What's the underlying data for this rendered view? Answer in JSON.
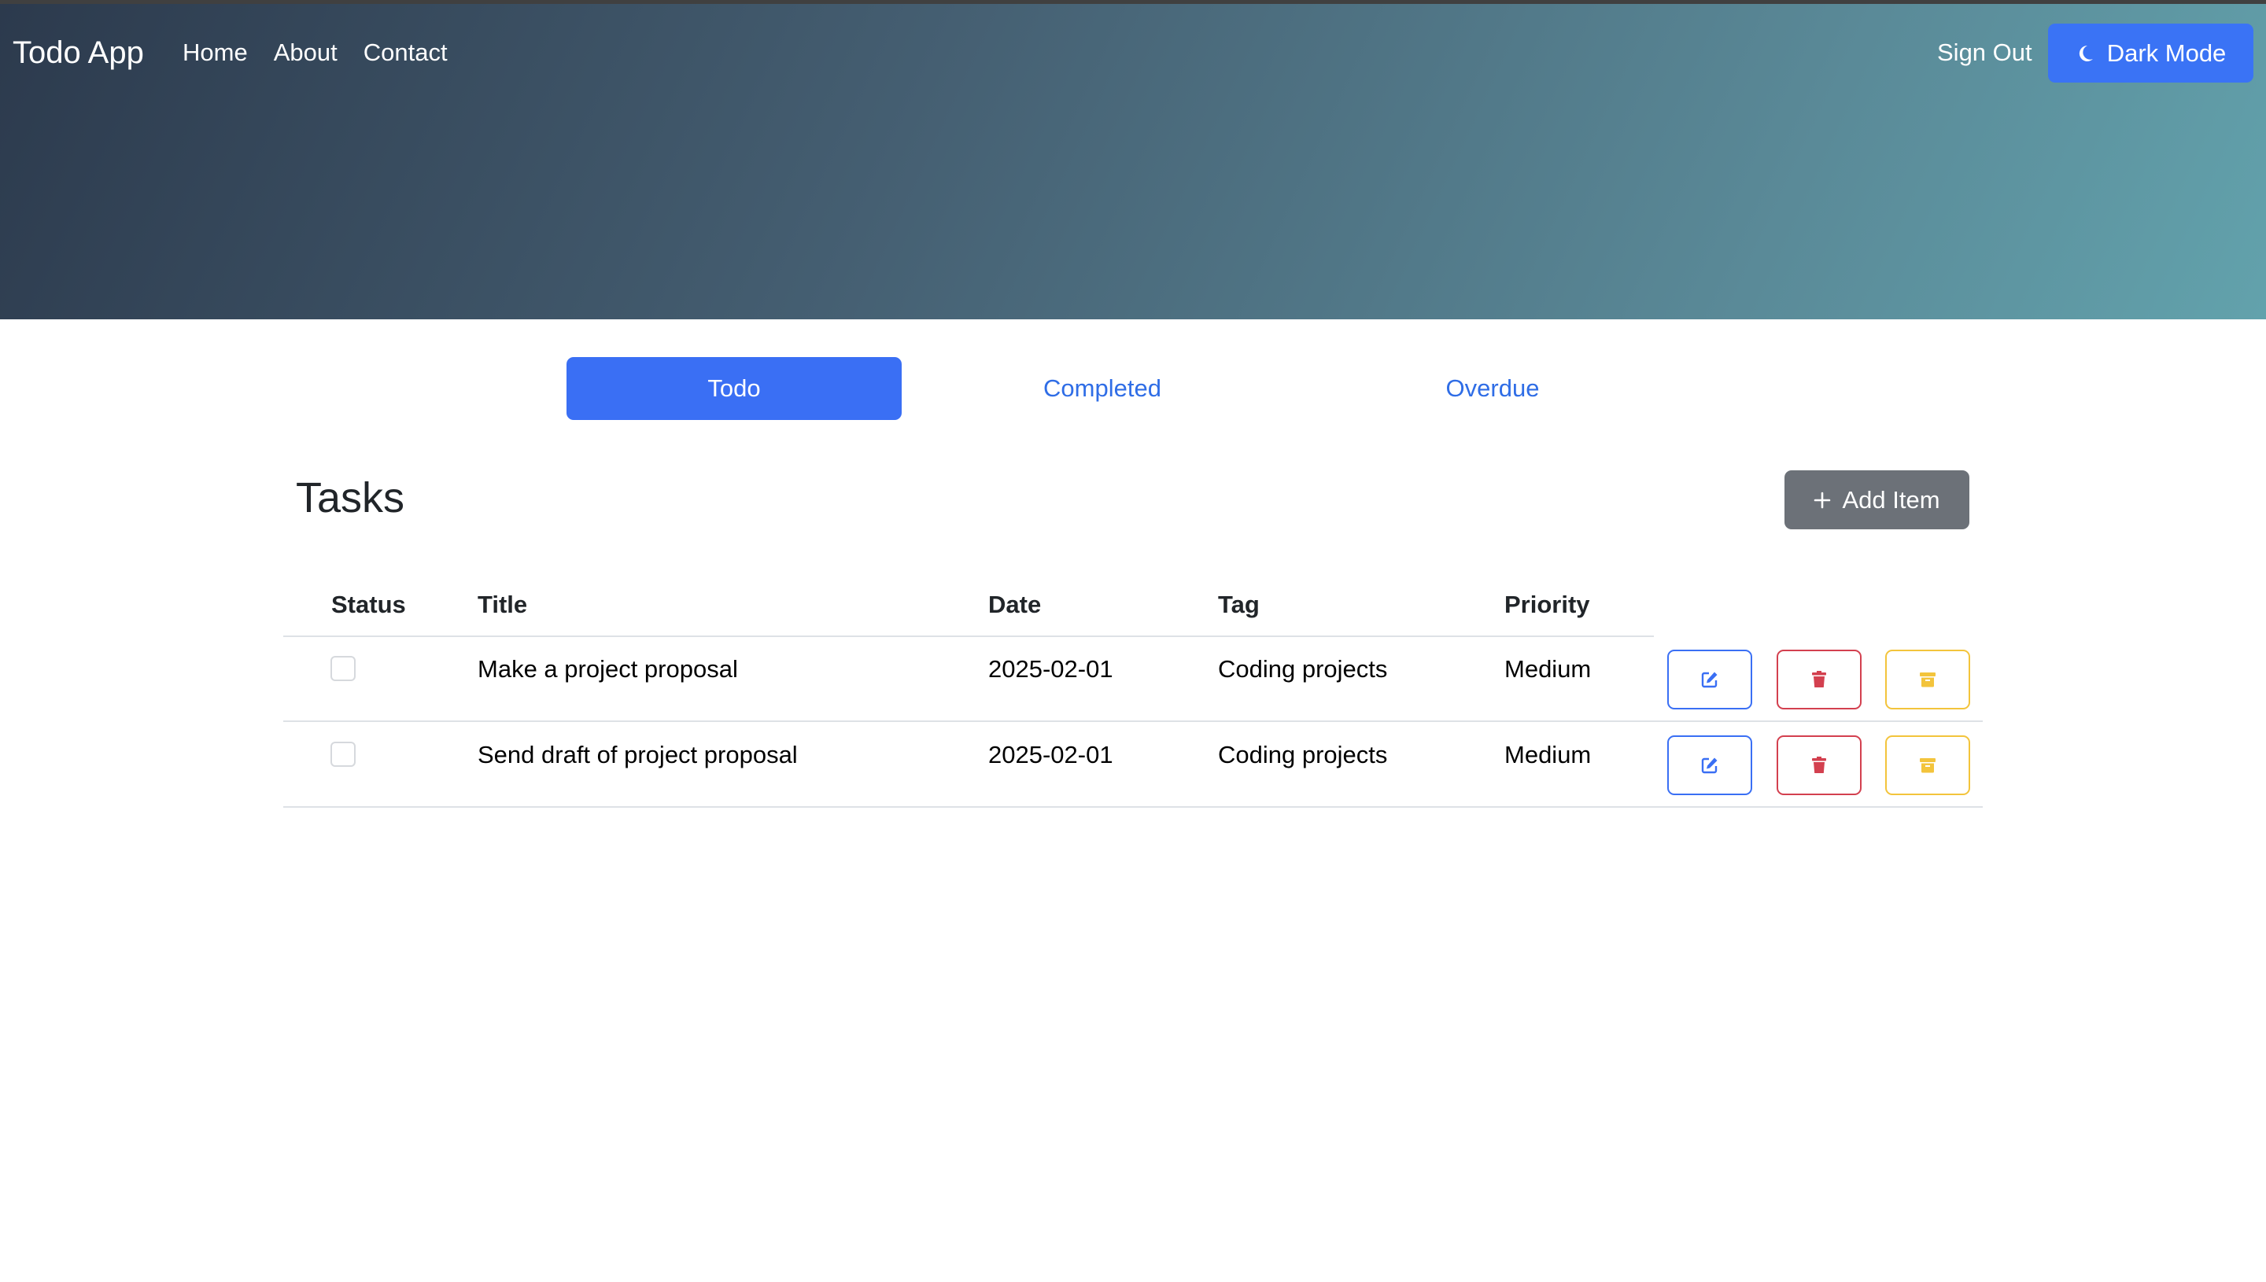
{
  "navbar": {
    "brand": "Todo App",
    "links": [
      "Home",
      "About",
      "Contact"
    ],
    "sign_out": "Sign Out",
    "dark_mode": "Dark Mode"
  },
  "tabs": [
    {
      "label": "Todo",
      "active": true
    },
    {
      "label": "Completed",
      "active": false
    },
    {
      "label": "Overdue",
      "active": false
    }
  ],
  "main": {
    "title": "Tasks",
    "add_button": "Add Item"
  },
  "table": {
    "columns": [
      "Status",
      "Title",
      "Date",
      "Tag",
      "Priority"
    ],
    "rows": [
      {
        "status": false,
        "title": "Make a project proposal",
        "date": "2025-02-01",
        "tag": "Coding projects",
        "priority": "Medium"
      },
      {
        "status": false,
        "title": "Send draft of project proposal",
        "date": "2025-02-01",
        "tag": "Coding projects",
        "priority": "Medium"
      }
    ]
  },
  "colors": {
    "primary": "#3a6ff4",
    "danger": "#d3404f",
    "warning": "#f3c43c",
    "secondary": "#6c7178",
    "hero_start": "#2c3a4d",
    "hero_end": "#62a2ac"
  },
  "icons": {
    "dark_mode": "moon-icon",
    "add": "plus-icon",
    "edit": "edit-icon",
    "delete": "trash-icon",
    "archive": "archive-icon"
  }
}
